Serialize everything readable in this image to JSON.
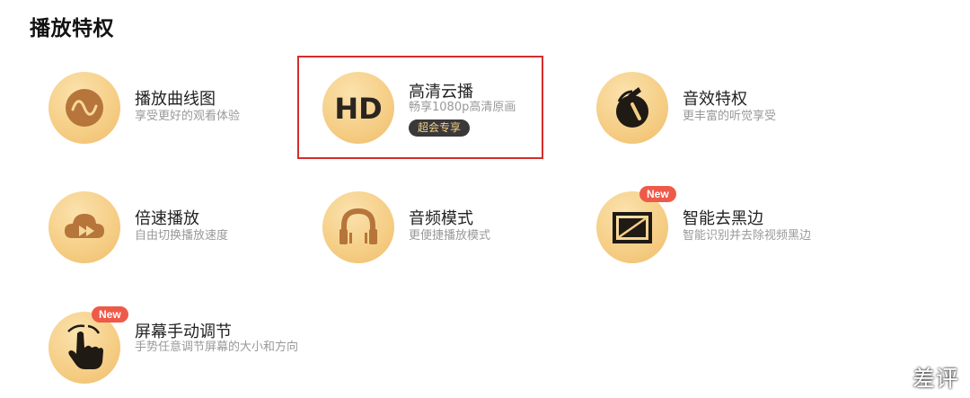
{
  "section": {
    "title": "播放特权"
  },
  "features": [
    {
      "title": "播放曲线图",
      "desc": "享受更好的观看体验",
      "icon": "wave-curve-icon"
    },
    {
      "title": "高清云播",
      "desc": "畅享1080p高清原画",
      "icon": "hd-icon",
      "hd_text": "HD",
      "tag": "超会专享",
      "highlighted": true
    },
    {
      "title": "音效特权",
      "desc": "更丰富的听觉享受",
      "icon": "music-note-icon"
    },
    {
      "title": "倍速播放",
      "desc": "自由切换播放速度",
      "icon": "speed-cloud-icon"
    },
    {
      "title": "音频模式",
      "desc": "更便捷播放模式",
      "icon": "headphones-icon"
    },
    {
      "title": "智能去黑边",
      "desc": "智能识别并去除视频黑边",
      "icon": "crop-frame-icon",
      "badge": "New"
    },
    {
      "title": "屏幕手动调节",
      "desc": "手势任意调节屏幕的大小和方向",
      "icon": "hand-gesture-icon",
      "badge": "New"
    }
  ],
  "watermark": "差评",
  "colors": {
    "accent_gold": "#f5cd84",
    "icon_dark": "#1f1a14",
    "icon_brown": "#b6753a",
    "badge_red": "#ee5a4a",
    "highlight_red": "#d62c2c"
  }
}
